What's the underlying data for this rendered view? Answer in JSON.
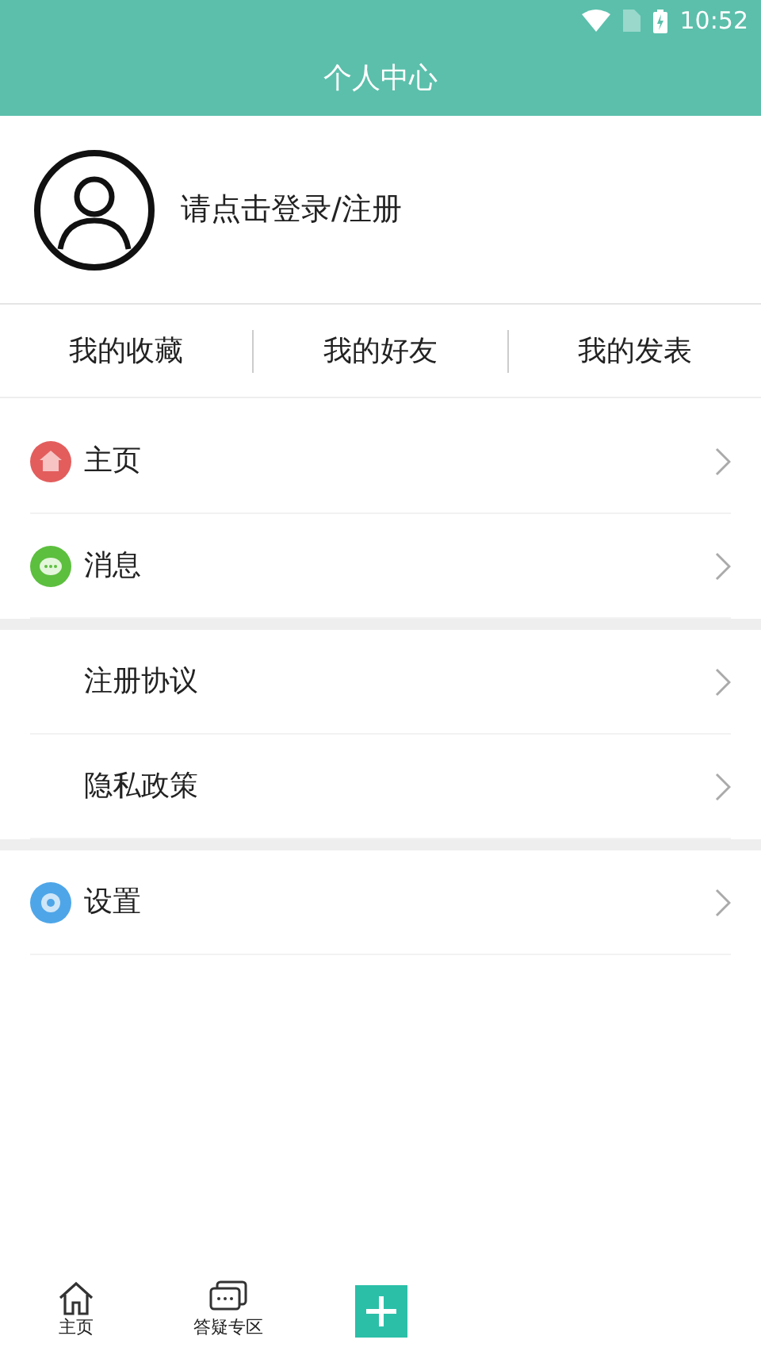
{
  "status_bar": {
    "time": "10:52"
  },
  "header": {
    "title": "个人中心"
  },
  "profile": {
    "login_text": "请点击登录/注册"
  },
  "quick_links": [
    {
      "label": "我的收藏"
    },
    {
      "label": "我的好友"
    },
    {
      "label": "我的发表"
    }
  ],
  "menu_groups": [
    {
      "items": [
        {
          "label": "主页",
          "kind": "home"
        },
        {
          "label": "消息",
          "kind": "message"
        }
      ]
    },
    {
      "items": [
        {
          "label": "注册协议",
          "kind": "plain"
        },
        {
          "label": "隐私政策",
          "kind": "plain"
        }
      ]
    },
    {
      "items": [
        {
          "label": "设置",
          "kind": "settings"
        }
      ]
    }
  ],
  "bottom_nav": [
    {
      "kind": "home",
      "label": "主页"
    },
    {
      "kind": "chat",
      "label": "答疑专区"
    },
    {
      "kind": "add"
    }
  ]
}
